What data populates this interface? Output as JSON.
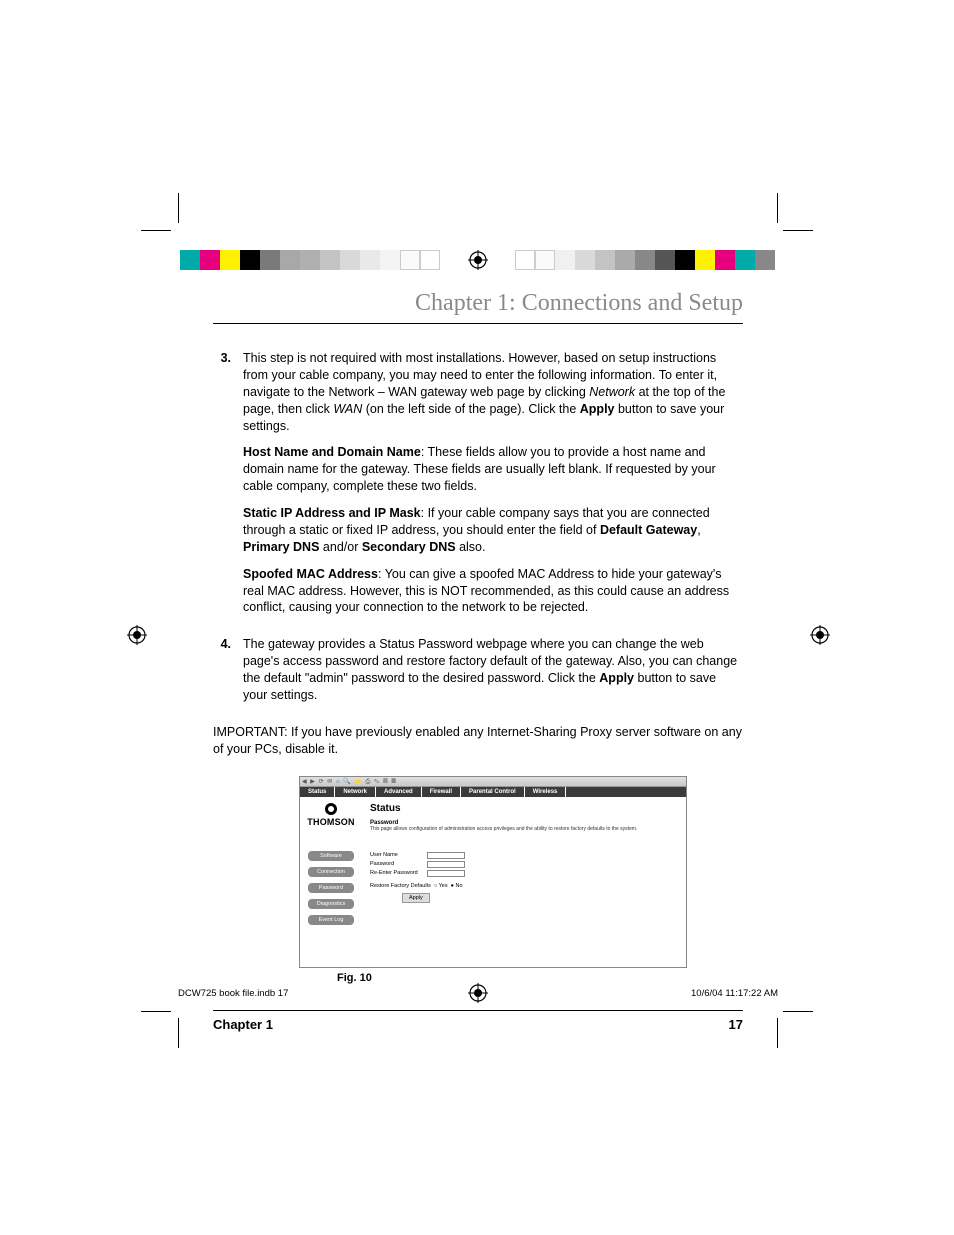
{
  "title": "Chapter 1: Connections and Setup",
  "steps": {
    "s3": {
      "num": "3.",
      "p1a": "This step is not required with most installations. However, based on setup instructions from your cable company, you may need to enter the following information. To enter it, navigate to the Network – WAN gateway web page by clicking ",
      "p1_i1": "Network",
      "p1b": " at the top of the page, then click ",
      "p1_i2": "WAN",
      "p1c": " (on the left side of the page). Click the ",
      "p1_b1": "Apply",
      "p1d": " button to save your settings.",
      "p2_b": "Host Name and Domain Name",
      "p2": ": These fields allow you to provide a host name and domain name for the gateway. These fields are usually left blank. If requested by your cable company, complete these two fields.",
      "p3_b1": "Static IP Address and IP Mask",
      "p3a": ": If your cable company says that you are connected through a static or fixed IP address, you should enter the field of ",
      "p3_b2": "Default Gateway",
      "p3b": ", ",
      "p3_b3": "Primary DNS",
      "p3c": " and/or ",
      "p3_b4": "Secondary DNS",
      "p3d": " also.",
      "p4_b": "Spoofed MAC Address",
      "p4": ": You can give a spoofed MAC Address to hide your gateway's real MAC address. However, this is NOT recommended, as this could cause an address conflict, causing your connection to the network to be rejected."
    },
    "s4": {
      "num": "4.",
      "p1a": "The gateway provides a Status Password webpage where you can change the web page's access password and restore factory default of the gateway. Also, you can change the default \"admin\" password to the desired password. Click the ",
      "p1_b1": "Apply",
      "p1b": " button to save your settings."
    }
  },
  "important": "IMPORTANT: If you have previously enabled any Internet-Sharing Proxy server software on any of your PCs, disable it.",
  "shot": {
    "tabs": [
      "Status",
      "Network",
      "Advanced",
      "Firewall",
      "Parental Control",
      "Wireless"
    ],
    "logo": "THOMSON",
    "side": [
      "Software",
      "Connection",
      "Password",
      "Diagnostics",
      "Event Log"
    ],
    "h1": "Status",
    "sub": "Password",
    "desc": "This page allows configuration of administration access privileges and the ability to restore factory defaults to the system.",
    "f_user": "User Name",
    "f_pass": "Password",
    "f_repass": "Re-Enter Password",
    "f_restore": "Restore Factory Defaults",
    "f_yes": "Yes",
    "f_no": "No",
    "apply": "Apply"
  },
  "fig": "Fig. 10",
  "footer": {
    "left": "Chapter 1",
    "right": "17"
  },
  "slug": {
    "left": "DCW725 book file.indb   17",
    "right": "10/6/04   11:17:22 AM"
  }
}
